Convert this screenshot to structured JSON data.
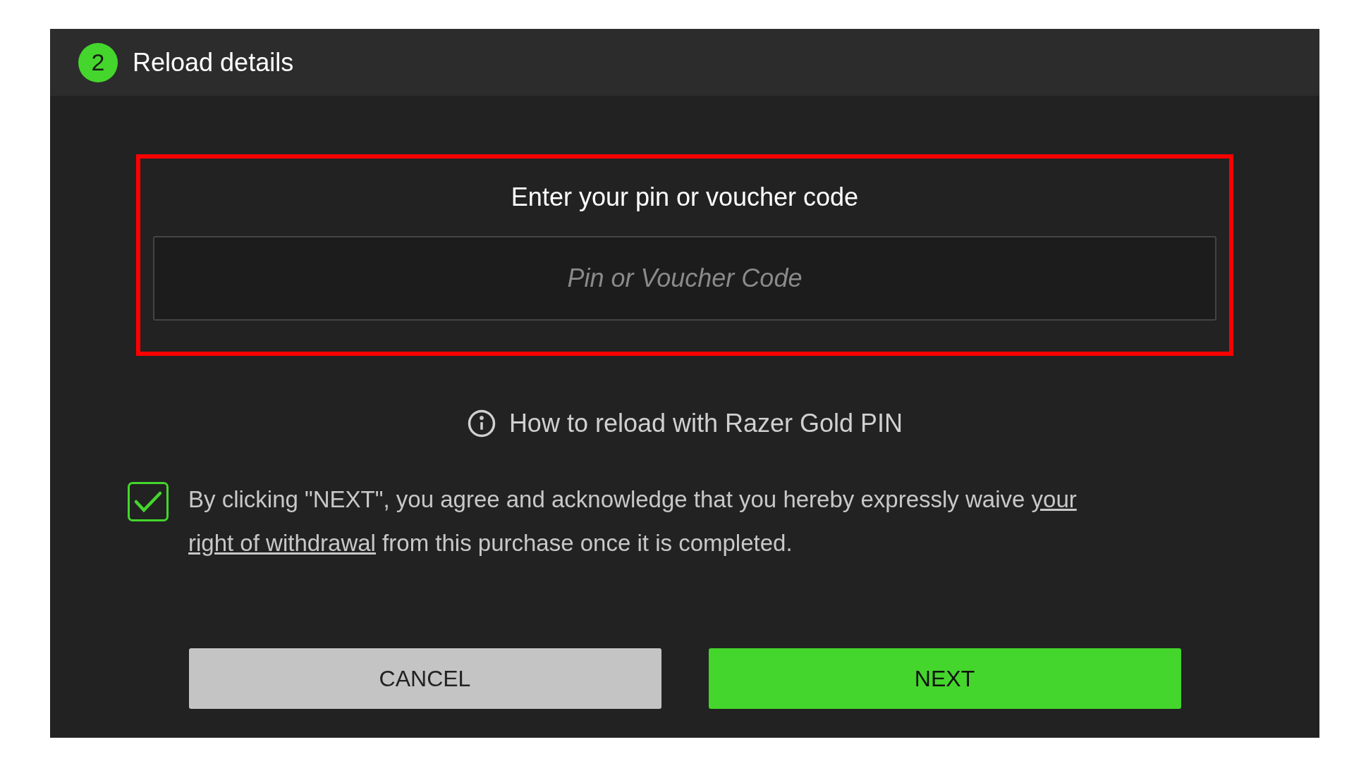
{
  "header": {
    "step": "2",
    "title": "Reload details"
  },
  "code_entry": {
    "title": "Enter your pin or voucher code",
    "placeholder": "Pin or Voucher Code",
    "highlighted": true
  },
  "help_link": "How to reload with Razer Gold PIN",
  "consent": {
    "checked": true,
    "parts": [
      {
        "kind": "text",
        "text": "By clicking \"NEXT\", you agree and acknowledge that you hereby expressly waive "
      },
      {
        "kind": "link",
        "text": "your"
      },
      {
        "kind": "link",
        "text": "right of withdrawal"
      },
      {
        "kind": "text",
        "text": " from this purchase once it is completed."
      }
    ]
  },
  "buttons": [
    {
      "kind": "secondary",
      "label": "CANCEL"
    },
    {
      "kind": "primary",
      "label": "NEXT"
    }
  ]
}
